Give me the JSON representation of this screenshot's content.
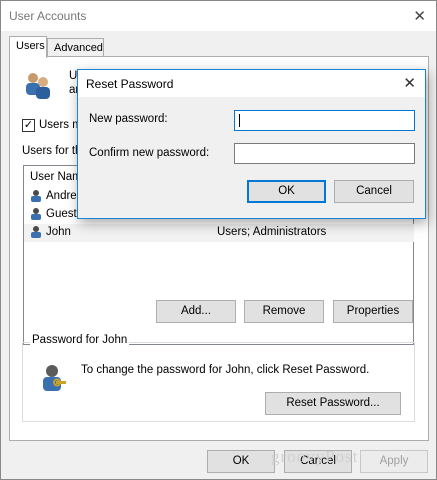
{
  "window": {
    "title": "User Accounts",
    "close_glyph": "✕"
  },
  "tabs": [
    {
      "label": "Users",
      "active": true
    },
    {
      "label": "Advanced",
      "active": false
    }
  ],
  "users_tab": {
    "intro_text": "Us",
    "intro_text_2": "an",
    "must_enter_checkbox_label": "Users mu",
    "must_enter_checked": true,
    "users_for_label": "Users for th",
    "list_header": "User Nam",
    "users": [
      {
        "name": "Andre",
        "group": ""
      },
      {
        "name": "Guest",
        "group": ""
      },
      {
        "name": "John",
        "group": "Users; Administrators"
      }
    ],
    "add_button": "Add...",
    "remove_button": "Remove",
    "properties_button": "Properties",
    "password_group_title": "Password for John",
    "password_text": "To change the password for John, click Reset Password.",
    "reset_password_button": "Reset Password..."
  },
  "footer": {
    "ok": "OK",
    "cancel": "Cancel",
    "apply": "Apply"
  },
  "dialog": {
    "title": "Reset Password",
    "close_glyph": "✕",
    "new_password_label": "New password:",
    "new_password_value": "",
    "confirm_password_label": "Confirm new password:",
    "confirm_password_value": "",
    "ok": "OK",
    "cancel": "Cancel"
  },
  "watermark": "groovyPost",
  "colors": {
    "accent": "#0078d7",
    "window_bg": "#f0f0f0"
  }
}
